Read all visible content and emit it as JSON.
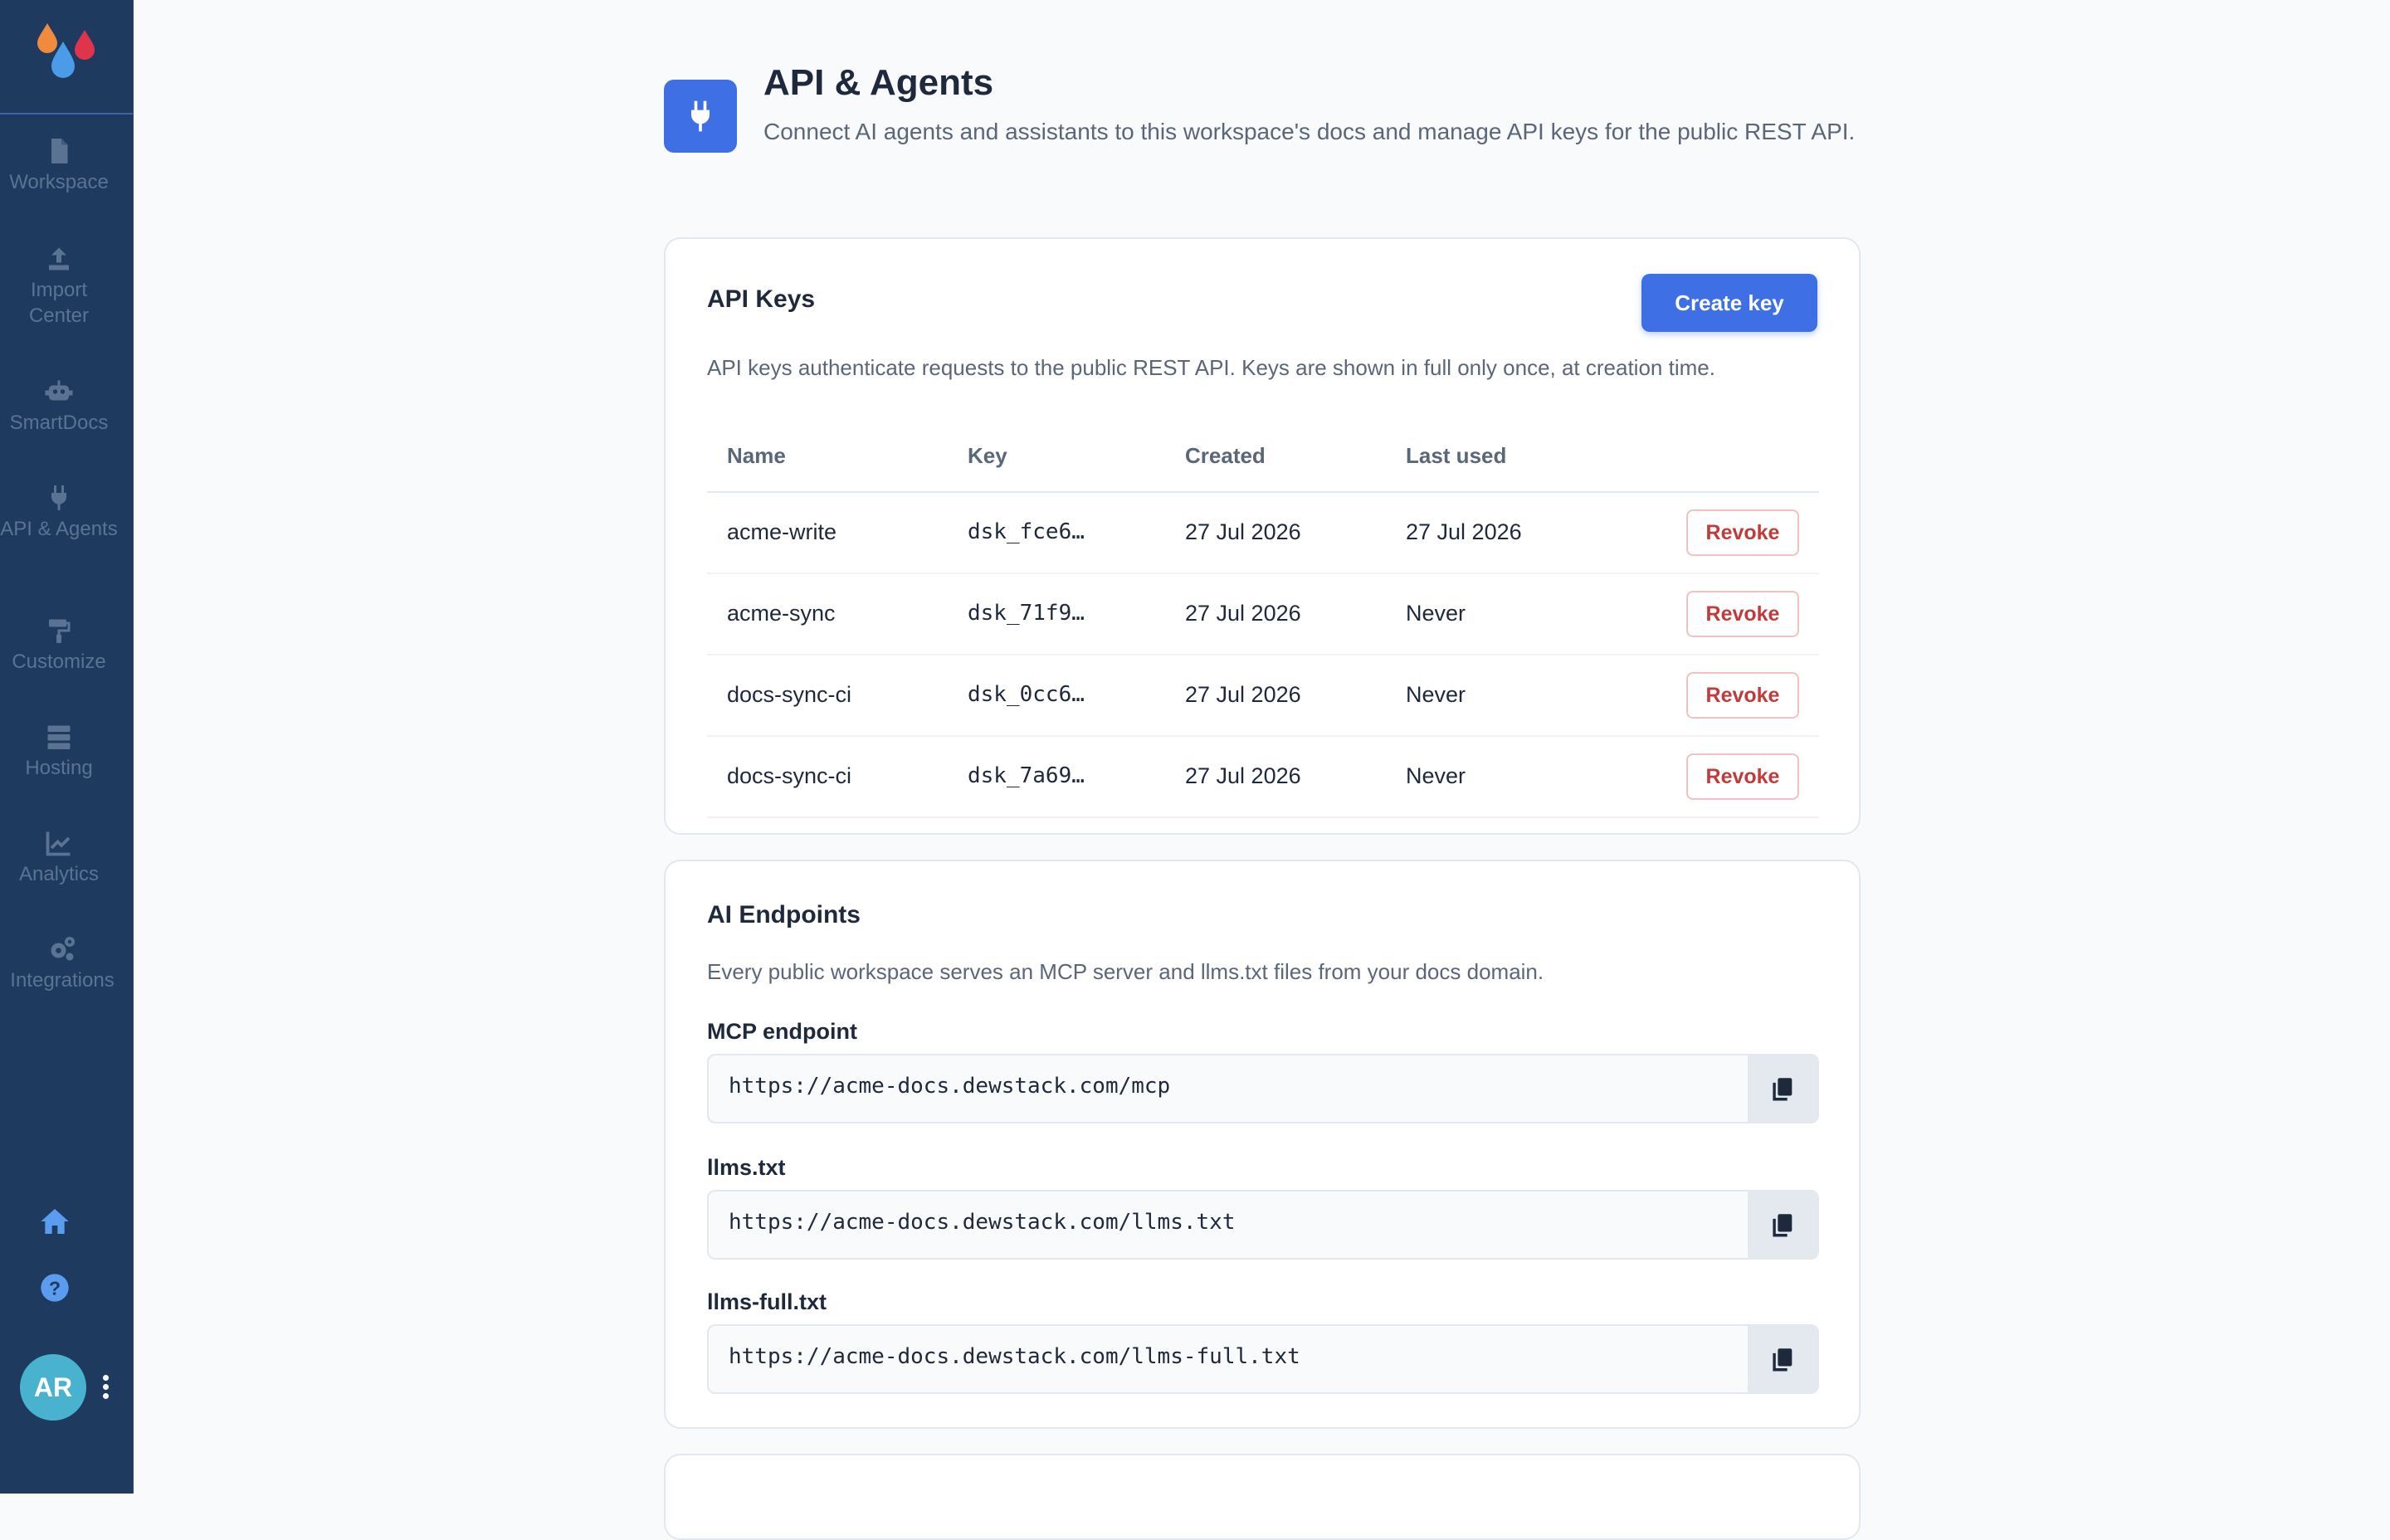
{
  "sidebar": {
    "items": [
      {
        "label": "Workspace",
        "icon": "document-icon"
      },
      {
        "label": "Import Center",
        "icon": "upload-icon"
      },
      {
        "label": "SmartDocs",
        "icon": "robot-icon"
      },
      {
        "label": "API & Agents",
        "icon": "plug-icon"
      },
      {
        "label": "Customize",
        "icon": "paint-roller-icon"
      },
      {
        "label": "Hosting",
        "icon": "server-icon"
      },
      {
        "label": "Analytics",
        "icon": "chart-line-icon"
      },
      {
        "label": "Integrations",
        "icon": "cogs-icon"
      }
    ],
    "avatar_initials": "AR"
  },
  "header": {
    "title": "API & Agents",
    "subtitle": "Connect AI agents and assistants to this workspace's docs and manage API keys for the public REST API."
  },
  "api_keys": {
    "title": "API Keys",
    "create_label": "Create key",
    "description": "API keys authenticate requests to the public REST API. Keys are shown in full only once, at creation time.",
    "columns": [
      "Name",
      "Key",
      "Created",
      "Last used"
    ],
    "rows": [
      {
        "name": "acme-write",
        "key": "dsk_fce6…",
        "created": "27 Jul 2026",
        "last_used": "27 Jul 2026",
        "action": "Revoke"
      },
      {
        "name": "acme-sync",
        "key": "dsk_71f9…",
        "created": "27 Jul 2026",
        "last_used": "Never",
        "action": "Revoke"
      },
      {
        "name": "docs-sync-ci",
        "key": "dsk_0cc6…",
        "created": "27 Jul 2026",
        "last_used": "Never",
        "action": "Revoke"
      },
      {
        "name": "docs-sync-ci",
        "key": "dsk_7a69…",
        "created": "27 Jul 2026",
        "last_used": "Never",
        "action": "Revoke"
      }
    ]
  },
  "ai_endpoints": {
    "title": "AI Endpoints",
    "description": "Every public workspace serves an MCP server and llms.txt files from your docs domain.",
    "fields": [
      {
        "label": "MCP endpoint",
        "value": "https://acme-docs.dewstack.com/mcp"
      },
      {
        "label": "llms.txt",
        "value": "https://acme-docs.dewstack.com/llms.txt"
      },
      {
        "label": "llms-full.txt",
        "value": "https://acme-docs.dewstack.com/llms-full.txt"
      }
    ]
  },
  "colors": {
    "sidebar_bg": "#1e3a5f",
    "accent": "#3f6fe4",
    "danger": "#c23b3b"
  }
}
